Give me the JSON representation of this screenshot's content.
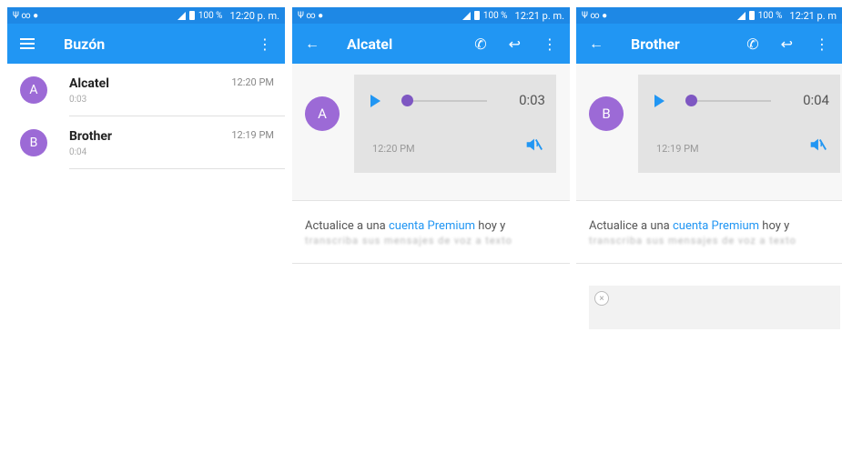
{
  "colors": {
    "status_bar": "#1e88e5",
    "app_bar": "#2196f3",
    "avatar": "#9c6ad6",
    "link": "#2196f3"
  },
  "screens": [
    {
      "status": {
        "icons": "Ψ ∞ ●",
        "battery": "100 %",
        "time": "12:20 p. m."
      },
      "app_bar": {
        "title": "Buzón",
        "menu_icon": "menu-icon",
        "more_icon": "more-vert-icon"
      },
      "items": [
        {
          "initial": "A",
          "name": "Alcatel",
          "duration": "0:03",
          "time": "12:20 PM"
        },
        {
          "initial": "B",
          "name": "Brother",
          "duration": "0:04",
          "time": "12:19 PM"
        }
      ]
    },
    {
      "status": {
        "icons": "Ψ ∞ ●",
        "battery": "100 %",
        "time": "12:21 p. m."
      },
      "app_bar": {
        "title": "Alcatel",
        "back_icon": "back-arrow-icon",
        "call_icon": "phone-icon",
        "reply_icon": "reply-icon",
        "more_icon": "more-vert-icon"
      },
      "message": {
        "initial": "A",
        "duration": "0:03",
        "time": "12:20 PM"
      },
      "promo": {
        "prefix": "Actualice a una ",
        "link": "cuenta Premium",
        "suffix": " hoy y",
        "line2": "transcriba sus mensajes de voz a texto"
      }
    },
    {
      "status": {
        "icons": "Ψ ∞ ●",
        "battery": "100 %",
        "time": "12:21 p. m"
      },
      "app_bar": {
        "title": "Brother",
        "back_icon": "back-arrow-icon",
        "call_icon": "phone-icon",
        "reply_icon": "reply-icon",
        "more_icon": "more-vert-icon"
      },
      "message": {
        "initial": "B",
        "duration": "0:04",
        "time": "12:19 PM"
      },
      "promo": {
        "prefix": "Actualice a una ",
        "link": "cuenta Premium",
        "suffix": " hoy y",
        "line2": "transcriba sus mensajes de voz a texto"
      },
      "close_label": "×"
    }
  ]
}
